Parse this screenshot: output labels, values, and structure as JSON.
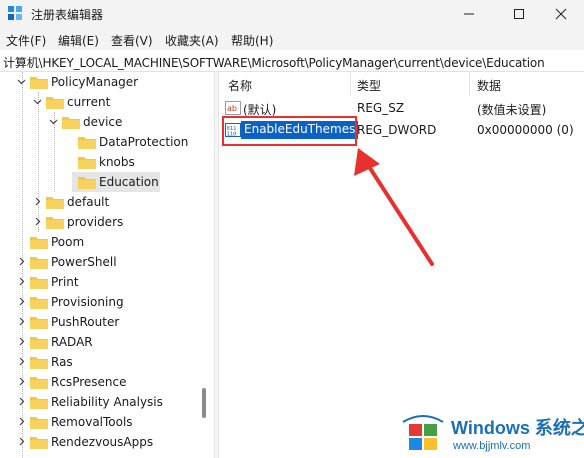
{
  "window": {
    "title": "注册表编辑器",
    "controls": [
      "minimize",
      "maximize",
      "close"
    ]
  },
  "menu": [
    {
      "label": "文件(F)"
    },
    {
      "label": "编辑(E)"
    },
    {
      "label": "查看(V)"
    },
    {
      "label": "收藏夹(A)"
    },
    {
      "label": "帮助(H)"
    }
  ],
  "address": {
    "path": "计算机\\HKEY_LOCAL_MACHINE\\SOFTWARE\\Microsoft\\PolicyManager\\current\\device\\Education"
  },
  "tree": {
    "items": [
      {
        "label": "PolicyManager",
        "expanded": true,
        "selected": false
      },
      {
        "label": "current",
        "expanded": true,
        "selected": false
      },
      {
        "label": "device",
        "expanded": true,
        "selected": false
      },
      {
        "label": "DataProtection",
        "expanded": false,
        "selected": false
      },
      {
        "label": "knobs",
        "expanded": false,
        "selected": false
      },
      {
        "label": "Education",
        "expanded": false,
        "selected": true
      },
      {
        "label": "default",
        "expanded": false,
        "selected": false
      },
      {
        "label": "providers",
        "expanded": false,
        "selected": false
      },
      {
        "label": "Poom",
        "expanded": false,
        "selected": false
      },
      {
        "label": "PowerShell",
        "expanded": false,
        "selected": false
      },
      {
        "label": "Print",
        "expanded": false,
        "selected": false
      },
      {
        "label": "Provisioning",
        "expanded": false,
        "selected": false
      },
      {
        "label": "PushRouter",
        "expanded": false,
        "selected": false
      },
      {
        "label": "RADAR",
        "expanded": false,
        "selected": false
      },
      {
        "label": "Ras",
        "expanded": false,
        "selected": false
      },
      {
        "label": "RcsPresence",
        "expanded": false,
        "selected": false
      },
      {
        "label": "Reliability Analysis",
        "expanded": false,
        "selected": false
      },
      {
        "label": "RemovalTools",
        "expanded": false,
        "selected": false
      },
      {
        "label": "RendezvousApps",
        "expanded": false,
        "selected": false
      }
    ]
  },
  "list": {
    "columns": {
      "name": "名称",
      "type": "类型",
      "data": "数据"
    },
    "rows": [
      {
        "name": "(默认)",
        "type": "REG_SZ",
        "data": "(数值未设置)",
        "icon": "string-value-icon",
        "selected": false
      },
      {
        "name": "EnableEduThemes",
        "type": "REG_DWORD",
        "data": "0x00000000 (0)",
        "icon": "binary-value-icon",
        "selected": true
      }
    ]
  },
  "annotation": {
    "highlight_color": "#e8312f",
    "arrow_color": "#e8312f"
  },
  "watermark": {
    "title": "Windows 系统之家",
    "url": "www.bjjmlv.com"
  },
  "colors": {
    "folder": "#f4c542",
    "selection": "#0a62c9",
    "tree_selected": "#e5e5e5",
    "chrome": "#f3f3f3"
  }
}
